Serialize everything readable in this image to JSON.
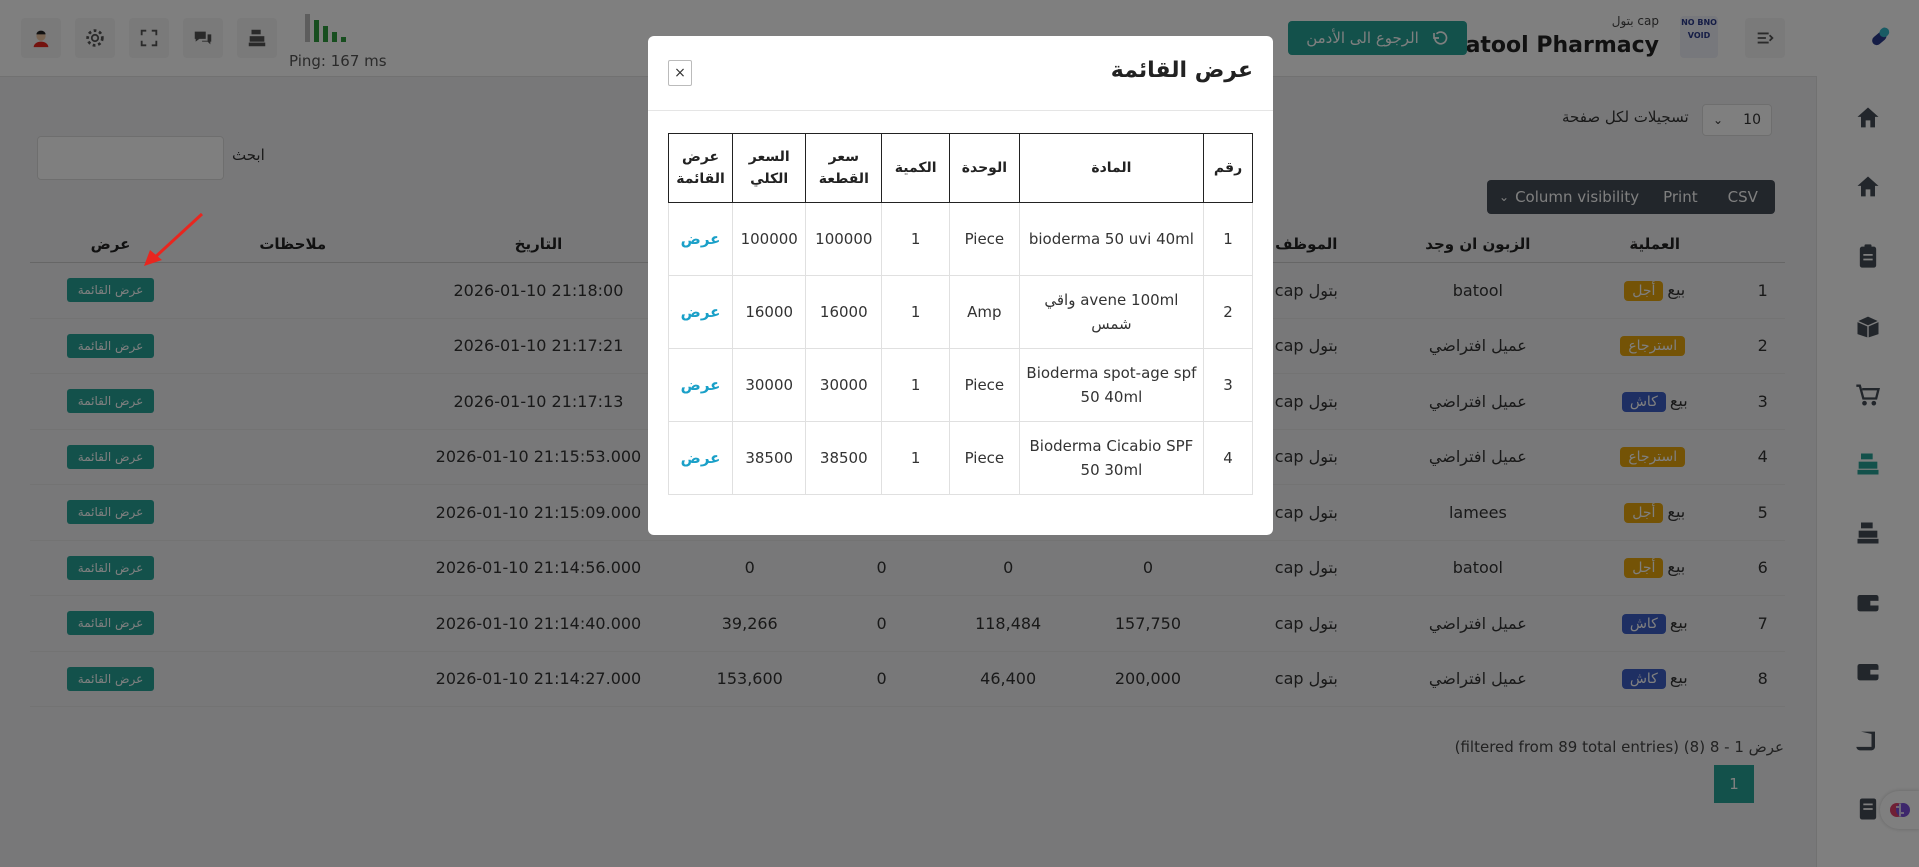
{
  "topbar": {
    "brand": "Batool Pharmacy",
    "user": "بتول cap",
    "back_admin": "الرجوع الى الأدمن",
    "ping": "Ping: 167 ms",
    "logo_text": "NO BNO VOID"
  },
  "controls": {
    "per_page_value": "10",
    "per_page_label": "تسجيلات لكل صفحة",
    "search_label": "ابحث",
    "buttons": [
      "Column visibility",
      "Print",
      "CSV"
    ]
  },
  "table": {
    "headers": [
      "العملية",
      "الزبون ان وجد",
      "الموظف",
      "التاريخ",
      "ملاحظات",
      "عرض"
    ],
    "view_label": "عرض القائمة",
    "rows": [
      {
        "num": "1",
        "type": "بيع",
        "badge": "أجل",
        "badge_kind": "ajal",
        "customer": "batool",
        "employee": "بتول cap",
        "c1": "",
        "c2": "",
        "c3": "",
        "c4": "",
        "date": "2026-01-10 21:18:00"
      },
      {
        "num": "2",
        "type": "",
        "badge": "استرجاع",
        "badge_kind": "rtn",
        "customer": "عميل افتراضي",
        "employee": "بتول cap",
        "c1": "",
        "c2": "",
        "c3": "",
        "c4": "",
        "date": "2026-01-10 21:17:21"
      },
      {
        "num": "3",
        "type": "بيع",
        "badge": "كاش",
        "badge_kind": "kash",
        "customer": "عميل افتراضي",
        "employee": "بتول cap",
        "c1": "",
        "c2": "",
        "c3": "",
        "c4": "",
        "date": "2026-01-10 21:17:13"
      },
      {
        "num": "4",
        "type": "",
        "badge": "استرجاع",
        "badge_kind": "rtn",
        "customer": "عميل افتراضي",
        "employee": "بتول cap",
        "c1": "",
        "c2": "",
        "c3": "",
        "c4": "",
        "date": "2026-01-10 21:15:53.000"
      },
      {
        "num": "5",
        "type": "بيع",
        "badge": "أجل",
        "badge_kind": "ajal",
        "customer": "lamees",
        "employee": "بتول cap",
        "c1": "",
        "c2": "",
        "c3": "",
        "c4": "",
        "date": "2026-01-10 21:15:09.000"
      },
      {
        "num": "6",
        "type": "بيع",
        "badge": "أجل",
        "badge_kind": "ajal",
        "customer": "batool",
        "employee": "بتول cap",
        "c1": "0",
        "c2": "0",
        "c3": "0",
        "c4": "0",
        "date": "2026-01-10 21:14:56.000"
      },
      {
        "num": "7",
        "type": "بيع",
        "badge": "كاش",
        "badge_kind": "kash",
        "customer": "عميل افتراضي",
        "employee": "بتول cap",
        "c1": "157,750",
        "c2": "118,484",
        "c3": "0",
        "c4": "39,266",
        "date": "2026-01-10 21:14:40.000"
      },
      {
        "num": "8",
        "type": "بيع",
        "badge": "كاش",
        "badge_kind": "kash",
        "customer": "عميل افتراضي",
        "employee": "بتول cap",
        "c1": "200,000",
        "c2": "46,400",
        "c3": "0",
        "c4": "153,600",
        "date": "2026-01-10 21:14:27.000"
      }
    ]
  },
  "footer": {
    "info": "عرض 1 - 8 (8) (filtered from 89 total entries)",
    "page": "1"
  },
  "modal": {
    "title": "عرض القائمة",
    "close": "×",
    "headers": [
      "رقم",
      "المادة",
      "الوحدة",
      "الكمية",
      "سعر القطعة",
      "السعر الكلي",
      "عرض القائمة"
    ],
    "link_label": "عرض",
    "rows": [
      {
        "num": "1",
        "item": "bioderma 50 uvi 40ml",
        "unit": "Piece",
        "qty": "1",
        "price": "100000",
        "total": "100000"
      },
      {
        "num": "2",
        "item": "avene 100ml واقي شمس",
        "unit": "Amp",
        "qty": "1",
        "price": "16000",
        "total": "16000"
      },
      {
        "num": "3",
        "item": "Bioderma spot-age spf 50 40ml",
        "unit": "Piece",
        "qty": "1",
        "price": "30000",
        "total": "30000"
      },
      {
        "num": "4",
        "item": "Bioderma Cicabio SPF 50 30ml",
        "unit": "Piece",
        "qty": "1",
        "price": "38500",
        "total": "38500"
      }
    ]
  },
  "colors": {
    "teal": "#27a397",
    "gold": "#e8a60c",
    "blue": "#3c5fc7",
    "dark": "#444c56",
    "link": "#1aa0c8",
    "red_arrow": "#e8261f"
  }
}
